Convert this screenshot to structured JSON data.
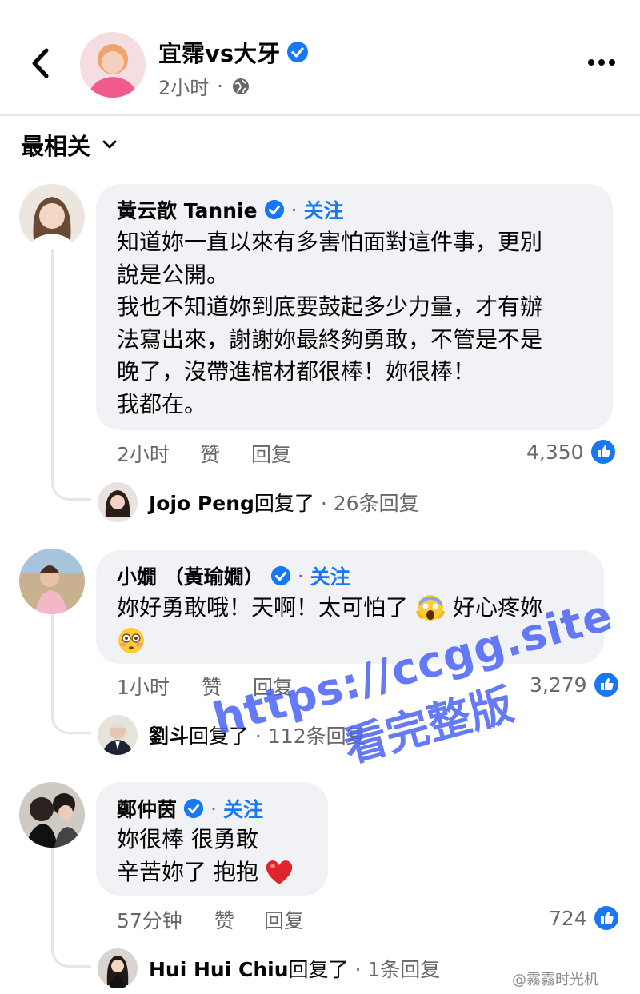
{
  "header": {
    "title": "宜霈vs大牙",
    "time": "2小时",
    "dot": "·"
  },
  "sort": {
    "label": "最相关"
  },
  "colors": {
    "accent": "#1877f2",
    "bubble": "#f0f2f5",
    "muted": "#65676b"
  },
  "comments": [
    {
      "author": "黃云歆 Tannie",
      "dot": "·",
      "follow": "关注",
      "lines": [
        "知道妳一直以來有多害怕面對這件事，更別",
        "說是公開。",
        "我也不知道妳到底要鼓起多少力量，才有辦",
        "法寫出來，謝謝妳最終夠勇敢，不管是不是",
        "晚了，沒帶進棺材都很棒！妳很棒！",
        "我都在。"
      ],
      "time": "2小时",
      "like": "赞",
      "reply": "回复",
      "likes": "4,350",
      "reply_row": {
        "name": "Jojo Peng",
        "action": "回复了",
        "dot": "·",
        "count": "26条回复"
      }
    },
    {
      "author": "小嫺 （黃瑜嫺）",
      "dot": "·",
      "follow": "关注",
      "lines": [
        "妳好勇敢哦！天啊！太可怕了",
        "好心疼妳"
      ],
      "time": "1小时",
      "like": "赞",
      "reply": "回复",
      "likes": "3,279",
      "reply_row": {
        "name": "劉斗",
        "action": "回复了",
        "dot": "·",
        "count": "112条回复"
      }
    },
    {
      "author": "鄭仲茵",
      "dot": "·",
      "follow": "关注",
      "lines": [
        "妳很棒 很勇敢",
        "辛苦妳了 抱抱"
      ],
      "time": "57分钟",
      "like": "赞",
      "reply": "回复",
      "likes": "724",
      "reply_row": {
        "name": "Hui Hui Chiu",
        "action": "回复了",
        "dot": "·",
        "count": "1条回复"
      }
    }
  ],
  "watermark": {
    "line1": "https://ccgg.site",
    "line2": "看完整版"
  },
  "credit": "@霧霧时光机"
}
